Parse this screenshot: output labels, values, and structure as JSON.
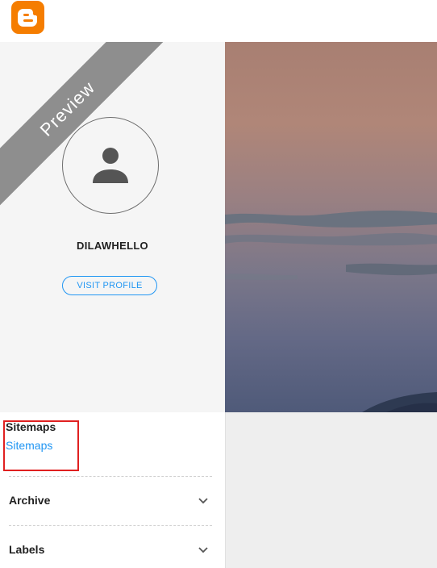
{
  "header": {
    "logo_icon": "blogger-logo-icon",
    "logo_color": "#f57d00"
  },
  "profile": {
    "ribbon_label": "Preview",
    "avatar_icon": "person-icon",
    "name": "DILAWHELLO",
    "visit_button_label": "VISIT PROFILE",
    "accent_color": "#2196f3"
  },
  "sidebar": {
    "sitemaps": {
      "title": "Sitemaps",
      "link_label": "Sitemaps"
    },
    "sections": [
      {
        "label": "Archive",
        "icon": "chevron-down-icon"
      },
      {
        "label": "Labels",
        "icon": "chevron-down-icon"
      }
    ]
  }
}
